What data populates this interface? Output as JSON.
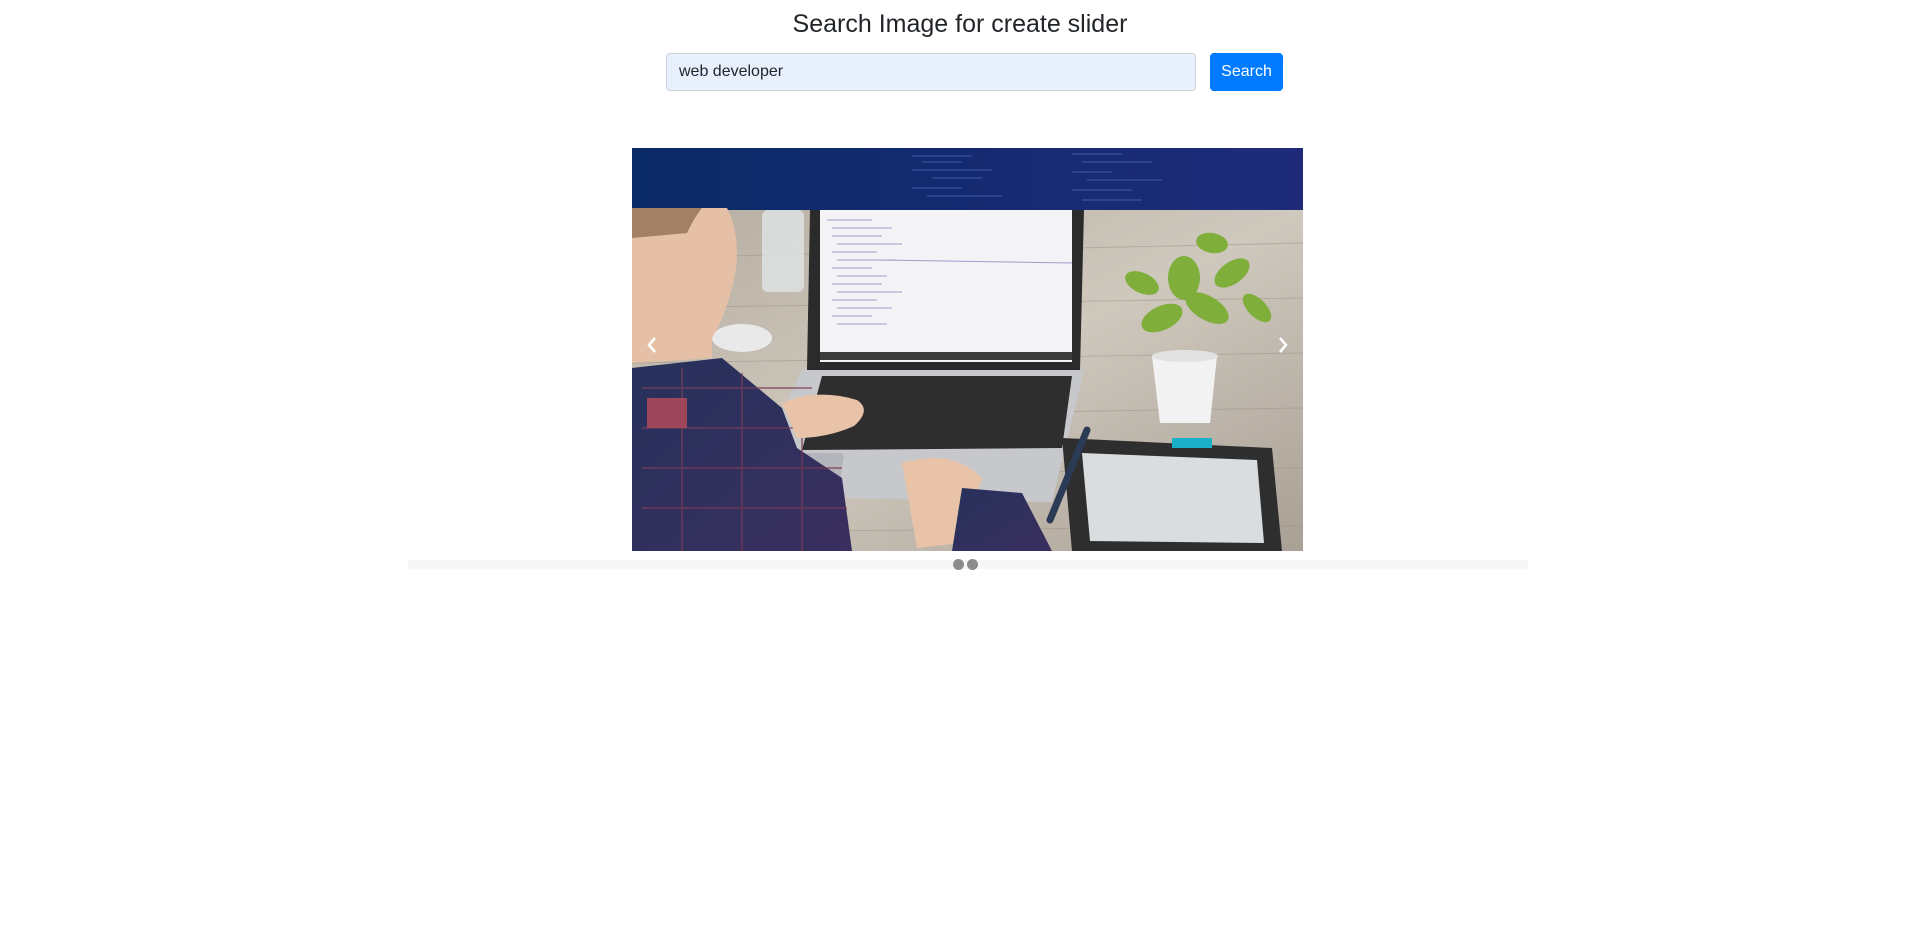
{
  "header": {
    "title": "Search Image for create slider"
  },
  "search": {
    "value": "web developer",
    "placeholder": "",
    "button_label": "Search"
  },
  "slider": {
    "current_slide": 1,
    "slide_count": 2,
    "prev_icon": "chevron-left-icon",
    "next_icon": "chevron-right-icon",
    "slide_description_icon": "developer-laptop-photo"
  },
  "colors": {
    "accent": "#007bff",
    "input_bg": "#e8f0fe",
    "dot": "#8c8c8c"
  }
}
